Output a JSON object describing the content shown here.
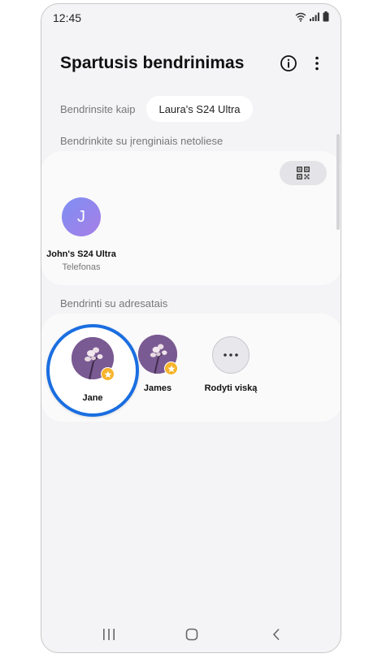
{
  "status_bar": {
    "time": "12:45"
  },
  "header": {
    "title": "Spartusis bendrinimas"
  },
  "share_as": {
    "label": "Bendrinsite kaip",
    "device": "Laura's S24 Ultra"
  },
  "nearby": {
    "section_label": "Bendrinkite su įrenginiais netoliese",
    "devices": [
      {
        "initial": "J",
        "name": "John's S24 Ultra",
        "type": "Telefonas"
      }
    ]
  },
  "contacts": {
    "section_label": "Bendrinti su adresatais",
    "items": [
      {
        "name": "Jane"
      },
      {
        "name": "James"
      }
    ],
    "show_all_label": "Rodyti viską"
  },
  "colors": {
    "highlight": "#1a6ee0",
    "star": "#f7b42c",
    "avatar_gradient": [
      "#7e8ff3",
      "#a77ee6"
    ]
  },
  "icons": [
    "wifi-icon",
    "signal-icon",
    "battery-icon",
    "info-icon",
    "more-vert-icon",
    "qr-code-icon",
    "star-icon",
    "more-horiz-icon",
    "recents-icon",
    "home-icon",
    "back-icon"
  ]
}
